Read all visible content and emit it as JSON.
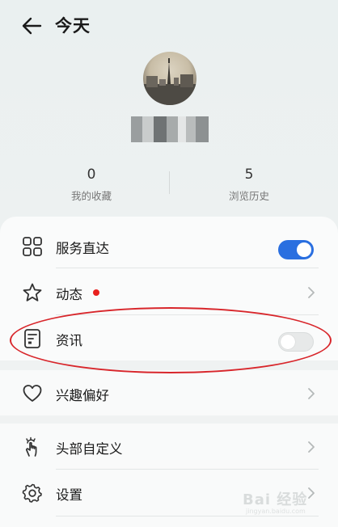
{
  "header": {
    "title": "今天",
    "back_icon": "arrow-left-icon"
  },
  "profile": {
    "username": ""
  },
  "stats": [
    {
      "value": "0",
      "label": "我的收藏"
    },
    {
      "value": "5",
      "label": "浏览历史"
    }
  ],
  "menu": {
    "service": {
      "label": "服务直达",
      "icon": "grid-icon",
      "toggle": true
    },
    "moments": {
      "label": "动态",
      "icon": "star-icon",
      "has_badge": true
    },
    "news": {
      "label": "资讯",
      "icon": "news-icon",
      "toggle": false
    },
    "interests": {
      "label": "兴趣偏好",
      "icon": "heart-icon"
    },
    "custom_header": {
      "label": "头部自定义",
      "icon": "tap-hand-icon"
    },
    "settings": {
      "label": "设置",
      "icon": "gear-icon"
    }
  },
  "colors": {
    "accent": "#2a6fe0",
    "badge": "#e8201e",
    "annotation": "#d8262b"
  },
  "watermark": {
    "text": "Bai 经验",
    "sub": "jingyan.baidu.com"
  }
}
